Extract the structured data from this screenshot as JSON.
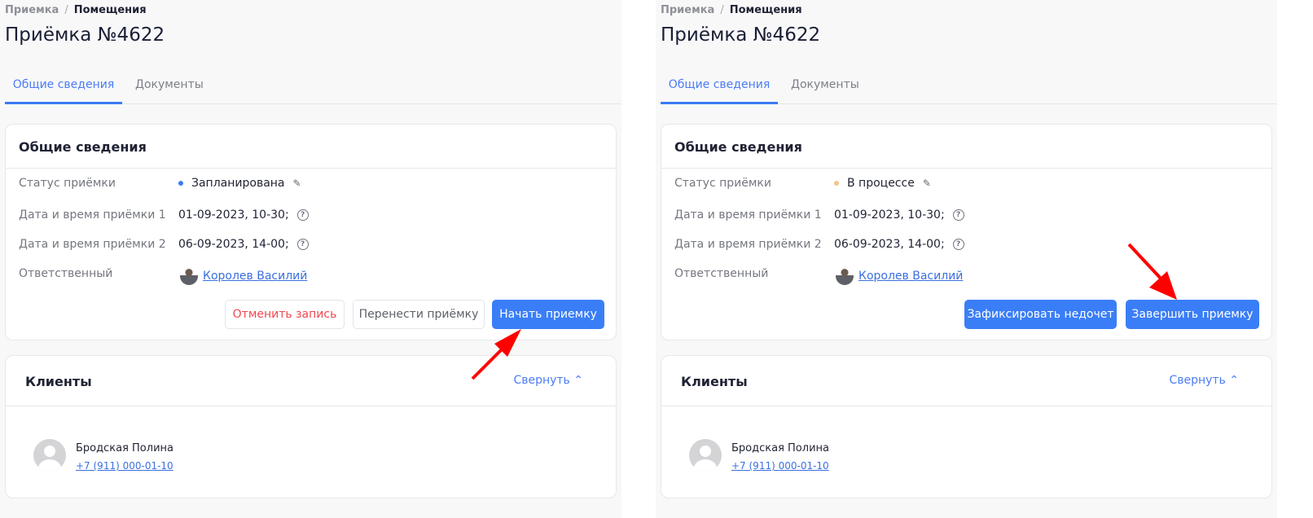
{
  "colors": {
    "accent": "#3a7ef7",
    "annotation": "#f00000"
  },
  "panels": [
    {
      "breadcrumb": [
        "Приемка",
        "Помещения"
      ],
      "title": "Приёмка №4622",
      "tabs": [
        "Общие сведения",
        "Документы"
      ],
      "card_title": "Общие сведения",
      "labels": [
        "Статус приёмки",
        "Дата и время приёмки 1",
        "Дата и время приёмки 2",
        "Ответственный"
      ],
      "status": "Запланирована",
      "status_color": "#3b7cf6",
      "date1": "01-09-2023, 10-30;",
      "date2": "06-09-2023, 14-00;",
      "responsible": "Королев Василий",
      "buttons": [
        "Отменить запись",
        "Перенести приёмку",
        "Начать приемку"
      ],
      "clients_title": "Клиенты",
      "collapse": "Свернуть",
      "client_name": "Бродская Полина",
      "client_phone": "+7 (911) 000-01-10"
    },
    {
      "breadcrumb": [
        "Приемка",
        "Помещения"
      ],
      "title": "Приёмка №4622",
      "tabs": [
        "Общие сведения",
        "Документы"
      ],
      "card_title": "Общие сведения",
      "labels": [
        "Статус приёмки",
        "Дата и время приёмки 1",
        "Дата и время приёмки 2",
        "Ответственный"
      ],
      "status": "В процессе",
      "status_color": "#f5c48a",
      "date1": "01-09-2023, 10-30;",
      "date2": "06-09-2023, 14-00;",
      "responsible": "Королев Василий",
      "buttons": [
        "Зафиксировать недочет",
        "Завершить приемку"
      ],
      "clients_title": "Клиенты",
      "collapse": "Свернуть",
      "client_name": "Бродская Полина",
      "client_phone": "+7 (911) 000-01-10"
    }
  ]
}
